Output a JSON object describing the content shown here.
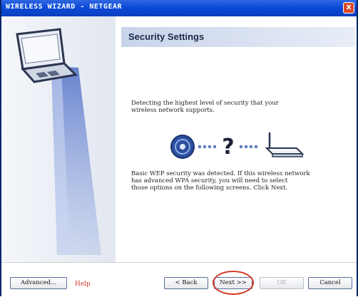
{
  "window": {
    "title": "WIRELESS WIZARD - NETGEAR",
    "close_glyph": "x"
  },
  "header": {
    "title": "Security Settings"
  },
  "content": {
    "detecting_text": "Detecting the highest level of security that your\nwireless network supports.",
    "unknown_mark": "?",
    "result_text": "Basic WEP security was detected. If this wireless network\nhas advanced WPA security, you will need to select\nthose options on the following screens. Click Next."
  },
  "footer": {
    "advanced_label": "Advanced...",
    "help_label": "Help",
    "back_label": "< Back",
    "next_label": "Next >>",
    "finish_label": "OK",
    "cancel_label": "Cancel"
  },
  "colors": {
    "titlebar": "#0b4ad8",
    "header_band": "#c8d4ea",
    "annotation_circle": "#d33a2b",
    "help_link": "#d13a2a"
  },
  "icons": [
    "laptop-icon",
    "wireless-signal-icon",
    "router-icon",
    "question-mark-icon",
    "close-icon"
  ]
}
